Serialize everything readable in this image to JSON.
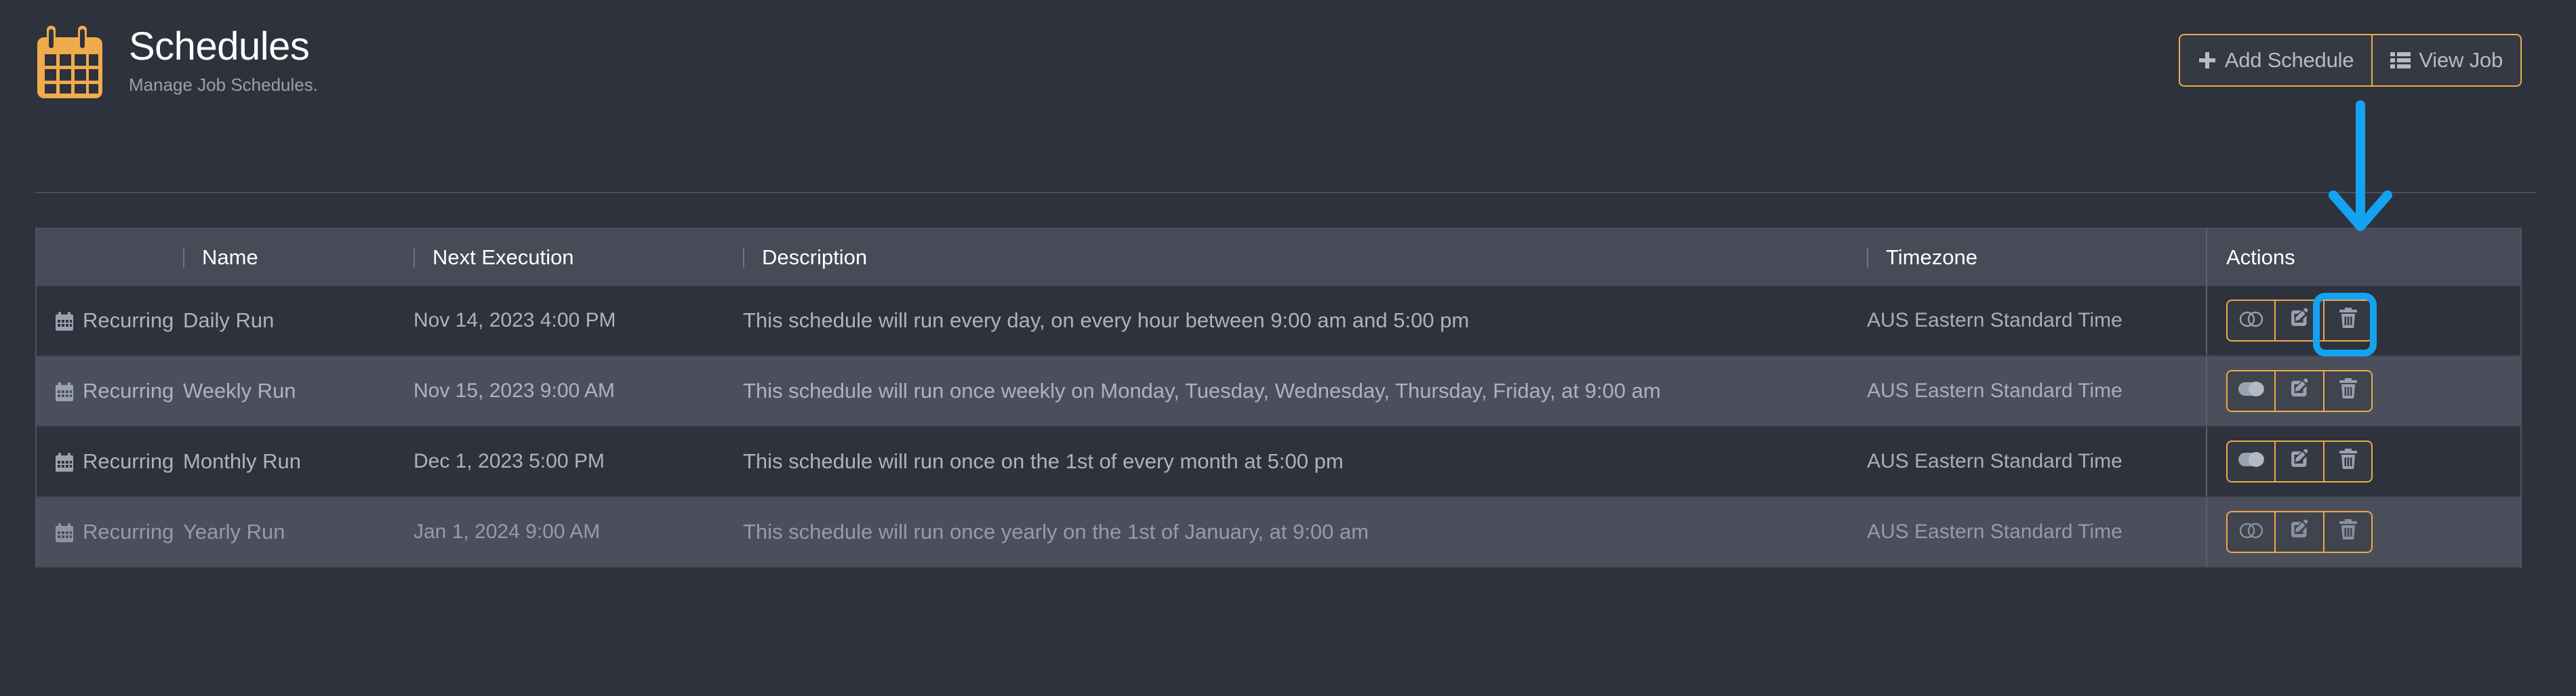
{
  "header": {
    "title": "Schedules",
    "subtitle": "Manage Job Schedules.",
    "logo_icon": "calendar-icon",
    "accent_color": "#f0a848",
    "buttons": [
      {
        "label": "Add Schedule",
        "icon": "plus-icon"
      },
      {
        "label": "View Job",
        "icon": "list-icon"
      }
    ]
  },
  "table": {
    "columns": [
      {
        "key": "type",
        "label": ""
      },
      {
        "key": "name",
        "label": "Name"
      },
      {
        "key": "next_execution",
        "label": "Next Execution"
      },
      {
        "key": "description",
        "label": "Description"
      },
      {
        "key": "timezone",
        "label": "Timezone"
      },
      {
        "key": "actions",
        "label": "Actions"
      }
    ],
    "rows": [
      {
        "type": "Recurring",
        "type_icon": "calendar-alt-icon",
        "name": "Daily Run",
        "next_execution": "Nov 14, 2023 4:00 PM",
        "description": "This schedule will run every day, on every hour between 9:00 am and 5:00 pm",
        "timezone": "AUS Eastern Standard Time",
        "toggle_state": "off",
        "actions": [
          "toggle-off-icon",
          "edit-icon",
          "trash-icon"
        ]
      },
      {
        "type": "Recurring",
        "type_icon": "calendar-alt-icon",
        "name": "Weekly Run",
        "next_execution": "Nov 15, 2023 9:00 AM",
        "description": "This schedule will run once weekly on Monday, Tuesday, Wednesday, Thursday, Friday, at 9:00 am",
        "timezone": "AUS Eastern Standard Time",
        "toggle_state": "on",
        "actions": [
          "toggle-on-icon",
          "edit-icon",
          "trash-icon"
        ]
      },
      {
        "type": "Recurring",
        "type_icon": "calendar-alt-icon",
        "name": "Monthly Run",
        "next_execution": "Dec 1, 2023 5:00 PM",
        "description": "This schedule will run once on the 1st of every month at 5:00 pm",
        "timezone": "AUS Eastern Standard Time",
        "toggle_state": "on",
        "actions": [
          "toggle-on-icon",
          "edit-icon",
          "trash-icon"
        ]
      },
      {
        "type": "Recurring",
        "type_icon": "calendar-alt-icon",
        "name": "Yearly Run",
        "next_execution": "Jan 1, 2024 9:00 AM",
        "description": "This schedule will run once yearly on the 1st of January, at 9:00 am",
        "timezone": "AUS Eastern Standard Time",
        "toggle_state": "off",
        "actions": [
          "toggle-off-icon",
          "edit-icon",
          "trash-icon"
        ]
      }
    ]
  },
  "annotation": {
    "color": "#13a3f0",
    "arrow": "down-arrow",
    "highlight_target": "edit-button-row-1"
  }
}
